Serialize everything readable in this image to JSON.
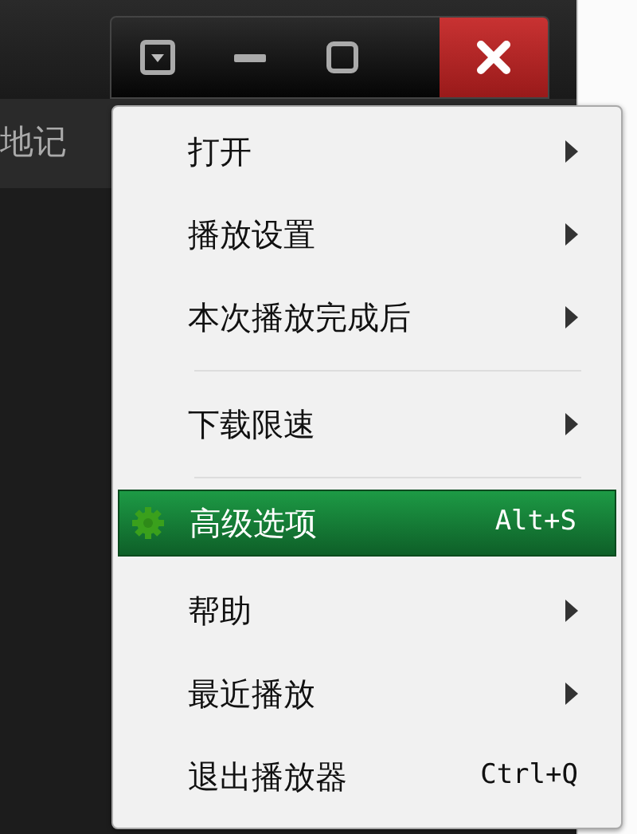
{
  "window": {
    "partial_tab": "地记"
  },
  "window_buttons": [
    {
      "kind": "menu"
    },
    {
      "kind": "minimize"
    },
    {
      "kind": "maximize"
    },
    {
      "kind": "close"
    }
  ],
  "menu": {
    "items": [
      {
        "kind": "submenu",
        "label": "打开",
        "selected": false
      },
      {
        "kind": "submenu",
        "label": "播放设置",
        "selected": false
      },
      {
        "kind": "submenu",
        "label": "本次播放完成后",
        "selected": false
      },
      {
        "kind": "separator"
      },
      {
        "kind": "submenu",
        "label": "下载限速",
        "selected": false
      },
      {
        "kind": "separator"
      },
      {
        "kind": "shortcut",
        "label": "高级选项",
        "shortcut": "Alt+S",
        "selected": true
      },
      {
        "kind": "submenu",
        "label": "帮助",
        "selected": false
      },
      {
        "kind": "submenu",
        "label": "最近播放",
        "selected": false
      },
      {
        "kind": "shortcut",
        "label": "退出播放器",
        "shortcut": "Ctrl+Q",
        "selected": false
      }
    ]
  }
}
